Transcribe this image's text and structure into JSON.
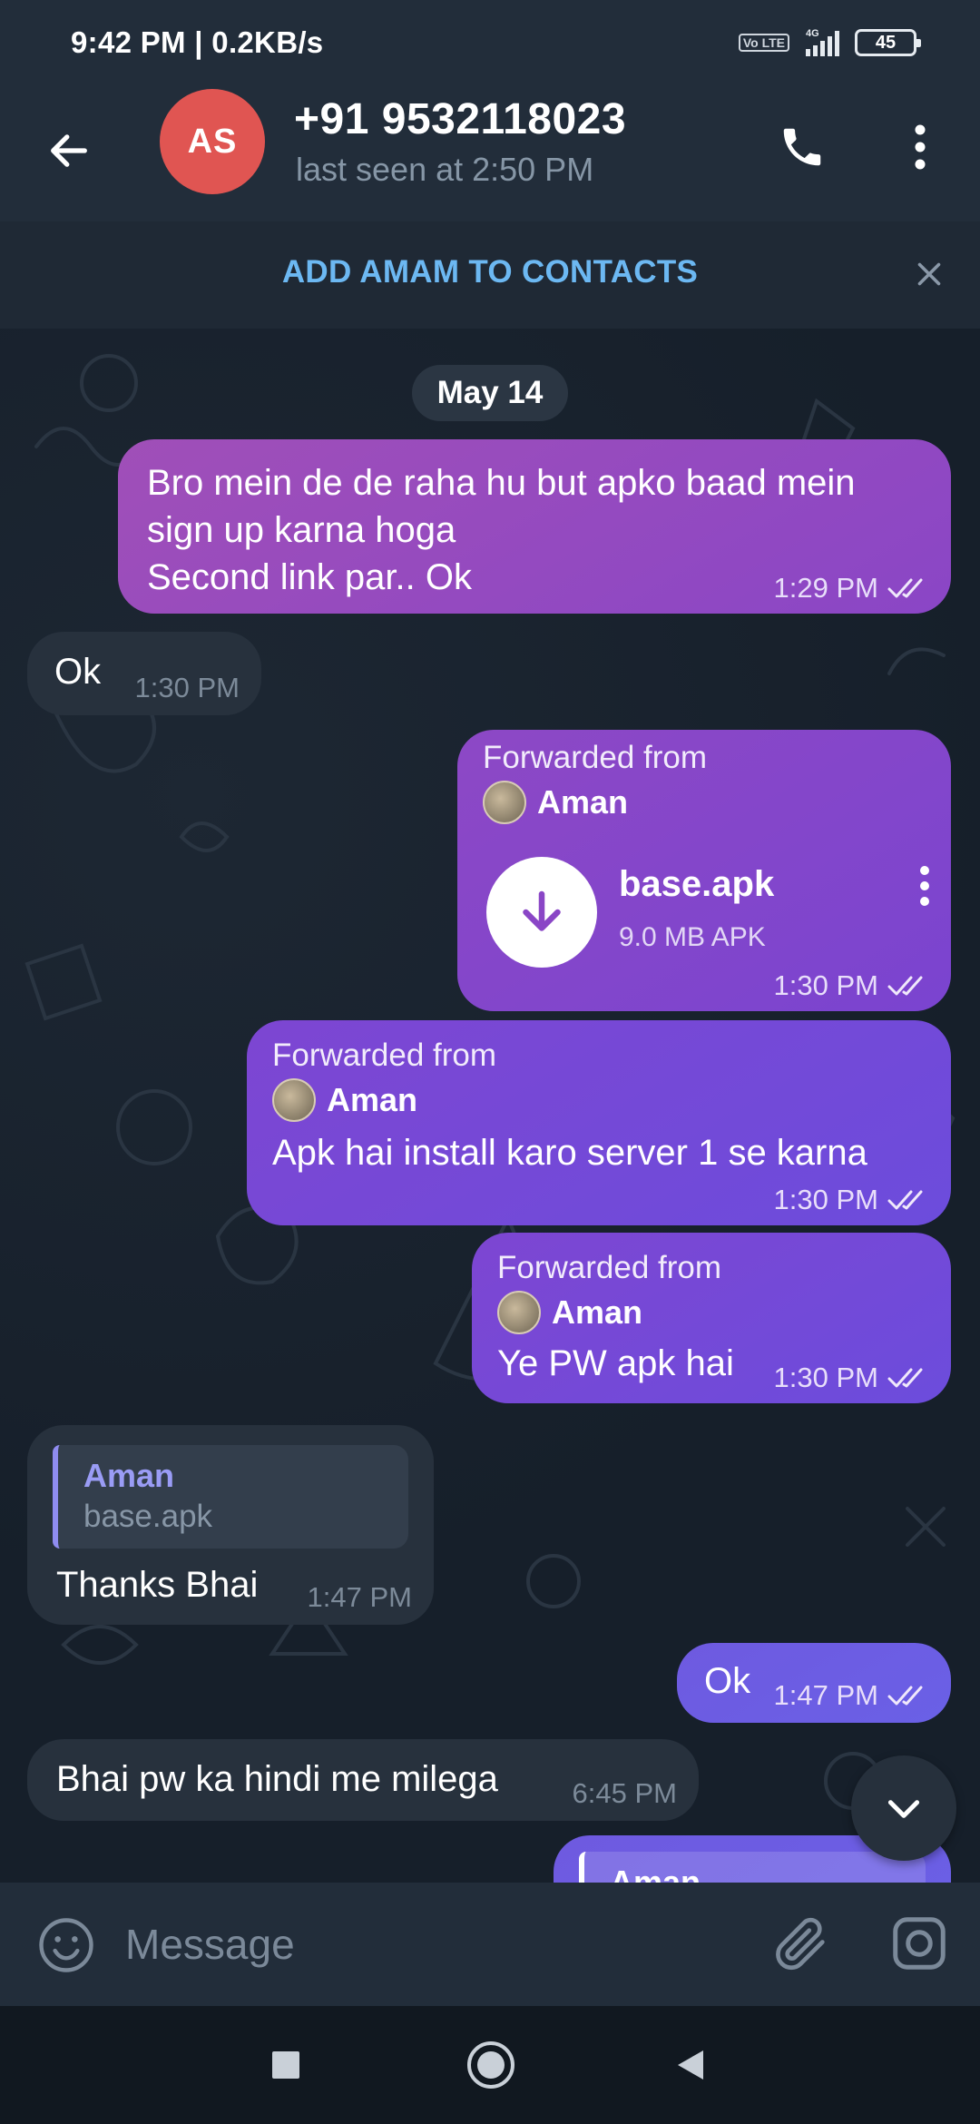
{
  "status_bar": {
    "time": "9:42 PM | 0.2KB/s",
    "volte": "Vo LTE",
    "network": "4G",
    "battery": "45"
  },
  "header": {
    "avatar_initials": "AS",
    "title": "+91 9532118023",
    "subtitle": "last seen at 2:50 PM",
    "avatar_color": "#e05552"
  },
  "add_contact": {
    "label": "ADD AMAM TO CONTACTS",
    "color": "#6cb8f2"
  },
  "date_pill": "May 14",
  "messages": [
    {
      "dir": "out",
      "lines": [
        "Bro mein de de raha hu but apko baad mein",
        "sign up karna hoga",
        "Second link par.. Ok"
      ],
      "time": "1:29 PM"
    },
    {
      "dir": "in",
      "text": "Ok",
      "time": "1:30 PM"
    },
    {
      "dir": "out",
      "forwarded_label": "Forwarded from",
      "forwarded_name": "Aman",
      "file_name": "base.apk",
      "file_size": "9.0 MB APK",
      "time": "1:30 PM"
    },
    {
      "dir": "out",
      "forwarded_label": "Forwarded from",
      "forwarded_name": "Aman",
      "text": "Apk hai install karo server 1 se karna",
      "time": "1:30 PM"
    },
    {
      "dir": "out",
      "forwarded_label": "Forwarded from",
      "forwarded_name": "Aman",
      "text": "Ye PW apk hai",
      "time": "1:30 PM"
    },
    {
      "dir": "in",
      "reply_name": "Aman",
      "reply_text": "base.apk",
      "text": "Thanks Bhai",
      "time": "1:47 PM"
    },
    {
      "dir": "out",
      "text": "Ok",
      "time": "1:47 PM"
    },
    {
      "dir": "in",
      "text": "Bhai pw ka hindi me milega",
      "time": "6:45 PM"
    },
    {
      "dir": "out",
      "reply_name": "Aman"
    }
  ],
  "input": {
    "placeholder": "Message"
  },
  "icons": {
    "back": "arrow-left-icon",
    "call": "phone-icon",
    "menu": "vertical-dots-icon",
    "close": "close-icon",
    "download": "download-arrow-icon",
    "read": "double-check-icon",
    "scroll": "chevron-down-icon",
    "emoji": "smiley-icon",
    "attach": "paperclip-icon",
    "camera": "instagram-camera-icon"
  }
}
